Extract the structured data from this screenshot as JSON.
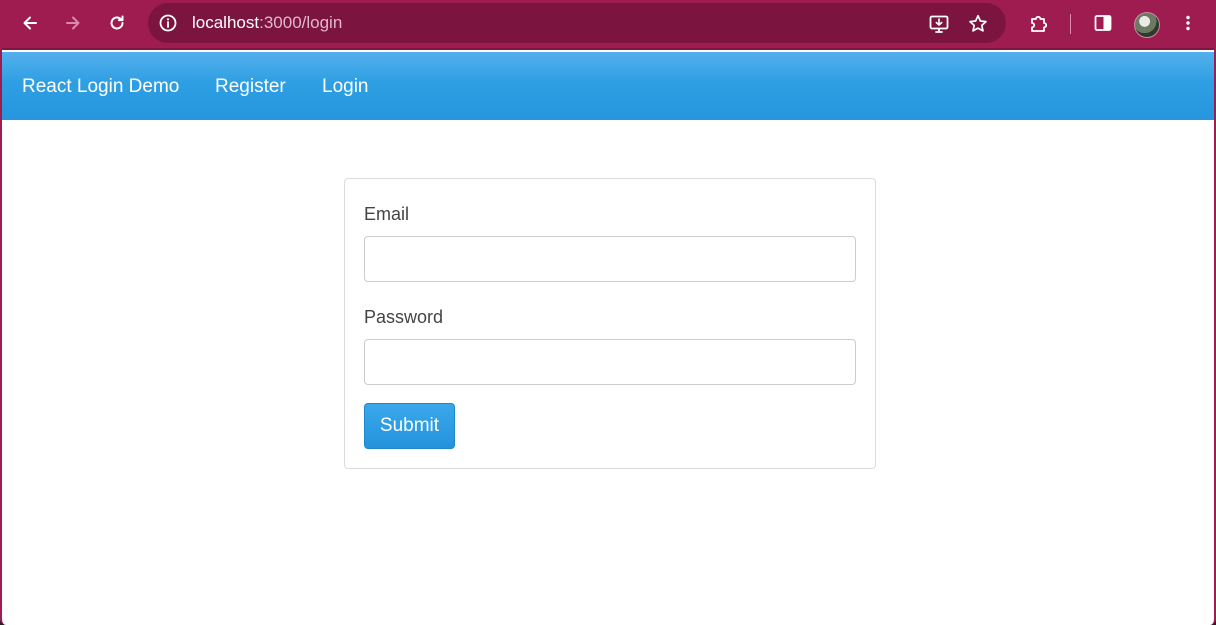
{
  "browser": {
    "url_host": "localhost",
    "url_path": ":3000/login",
    "icons": {
      "back": "back-arrow-icon",
      "forward": "forward-arrow-icon",
      "reload": "reload-icon",
      "site_info": "info-icon",
      "install": "install-app-icon",
      "bookmark": "star-icon",
      "extensions": "puzzle-icon",
      "side_panel": "side-panel-icon",
      "menu": "kebab-menu-icon"
    },
    "colors": {
      "frame": "#9e1c4f",
      "omnibox": "#7b1540"
    }
  },
  "navbar": {
    "brand": "React Login Demo",
    "links": [
      {
        "label": "Register"
      },
      {
        "label": "Login"
      }
    ],
    "color": "#2e9fe3"
  },
  "form": {
    "email": {
      "label": "Email",
      "value": "",
      "placeholder": ""
    },
    "password": {
      "label": "Password",
      "value": "",
      "placeholder": ""
    },
    "submit_label": "Submit"
  }
}
